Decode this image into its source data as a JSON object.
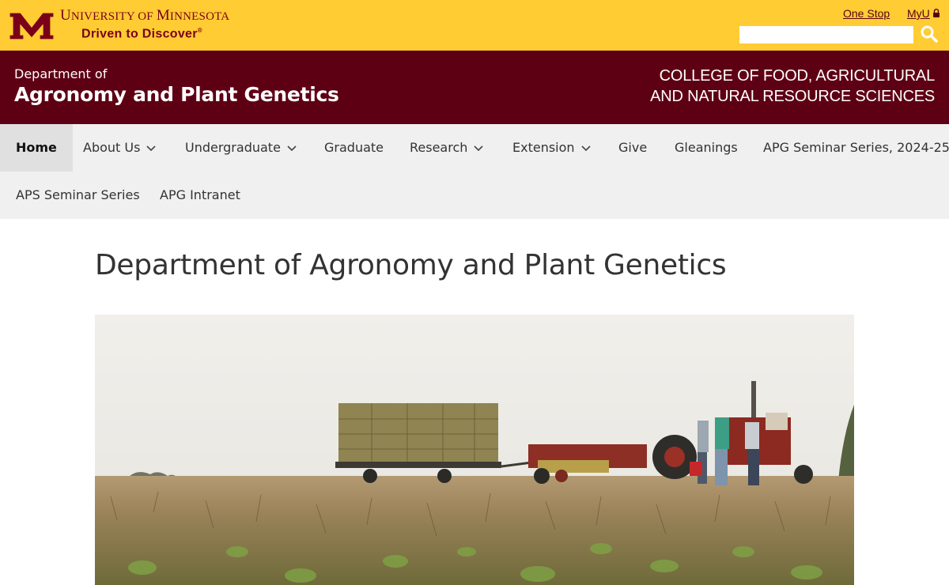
{
  "header": {
    "university_prefix": "U",
    "university_rest": "NIVERSITY OF ",
    "university_m": "M",
    "university_rest2": "INNESOTA",
    "tagline": "Driven to Discover",
    "tagline_mark": "®",
    "links": {
      "one_stop": "One Stop",
      "myu": "MyU"
    },
    "search": {
      "placeholder": "",
      "value": ""
    },
    "colors": {
      "gold": "#ffcc33",
      "maroon": "#7a0019"
    }
  },
  "department": {
    "prefix": "Department of",
    "name": "Agronomy and Plant Genetics",
    "college_line1": "COLLEGE OF FOOD, AGRICULTURAL",
    "college_line2": "AND NATURAL RESOURCE SCIENCES"
  },
  "nav": {
    "items": [
      {
        "label": "Home",
        "active": true
      },
      {
        "label": "About Us",
        "dropdown": true
      },
      {
        "label": "Undergraduate",
        "dropdown": true
      },
      {
        "label": "Graduate"
      },
      {
        "label": "Research",
        "dropdown": true
      },
      {
        "label": "Extension",
        "dropdown": true
      },
      {
        "label": "Give"
      },
      {
        "label": "Gleanings"
      },
      {
        "label": "APG Seminar Series, 2024-25"
      },
      {
        "label": "APS Seminar Series"
      },
      {
        "label": "APG Intranet"
      }
    ]
  },
  "main": {
    "title": "Department of Agronomy and Plant Genetics",
    "hero_image": "field-with-hay-wagon-and-tractor"
  }
}
